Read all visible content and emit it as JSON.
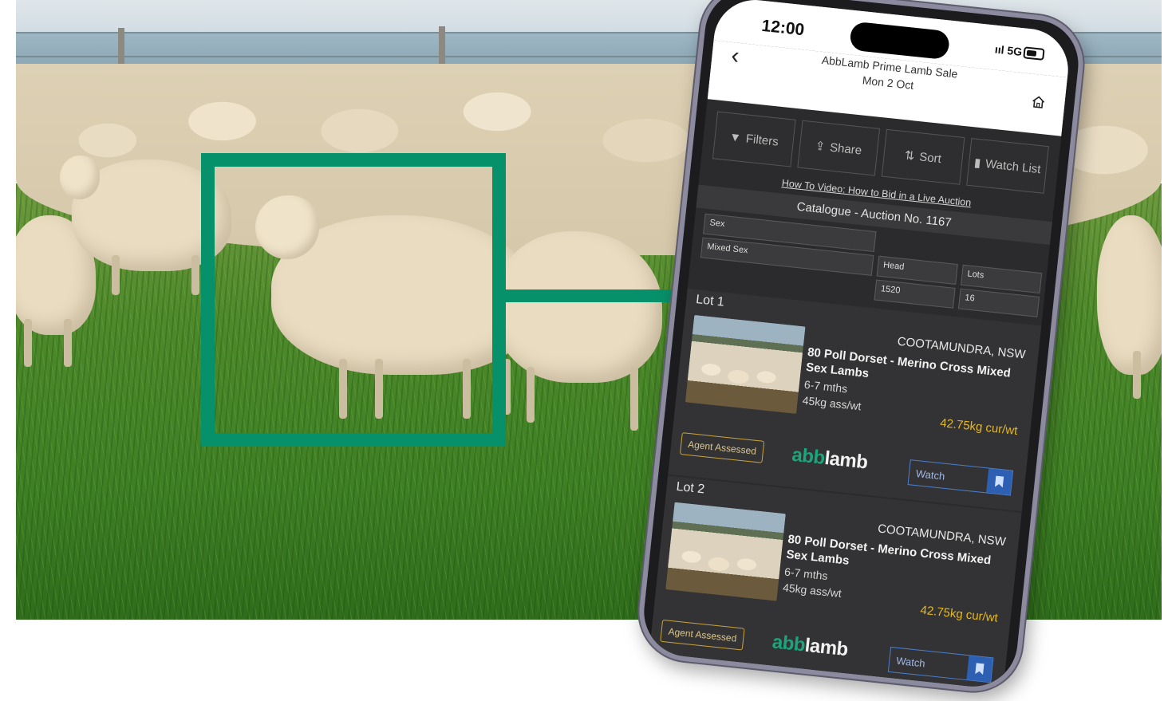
{
  "status_bar": {
    "time": "12:00",
    "signal": "ııl 5G"
  },
  "app_bar": {
    "title": "AbbLamb Prime Lamb Sale",
    "date": "Mon 2 Oct"
  },
  "toolbar": {
    "filters": "Filters",
    "share": "Share",
    "sort": "Sort",
    "watch_list": "Watch List"
  },
  "video_link": "How To Video: How to Bid in a Live Auction",
  "catalogue_title": "Catalogue - Auction No. 1167",
  "filters": {
    "sex_label": "Sex",
    "sex_value": "Mixed Sex",
    "head_label": "Head",
    "head_value": "1520",
    "lots_label": "Lots",
    "lots_value": "16"
  },
  "lots": [
    {
      "label": "Lot 1",
      "location": "COOTAMUNDRA, NSW",
      "description": "80 Poll Dorset - Merino Cross Mixed Sex Lambs",
      "age": "6-7 mths",
      "ass_weight": "45kg ass/wt",
      "cur_weight": "42.75kg cur/wt",
      "agent": "Agent Assessed",
      "watch": "Watch"
    },
    {
      "label": "Lot 2",
      "location": "COOTAMUNDRA, NSW",
      "description": "80 Poll Dorset - Merino Cross Mixed Sex Lambs",
      "age": "6-7 mths",
      "ass_weight": "45kg ass/wt",
      "cur_weight": "42.75kg cur/wt",
      "agent": "Agent Assessed",
      "watch": "Watch"
    }
  ],
  "brand": {
    "abb": "abb",
    "lamb": "lamb"
  },
  "colors": {
    "highlight": "#07916a",
    "price": "#e6b820",
    "watch_accent": "#2d5fb2"
  }
}
